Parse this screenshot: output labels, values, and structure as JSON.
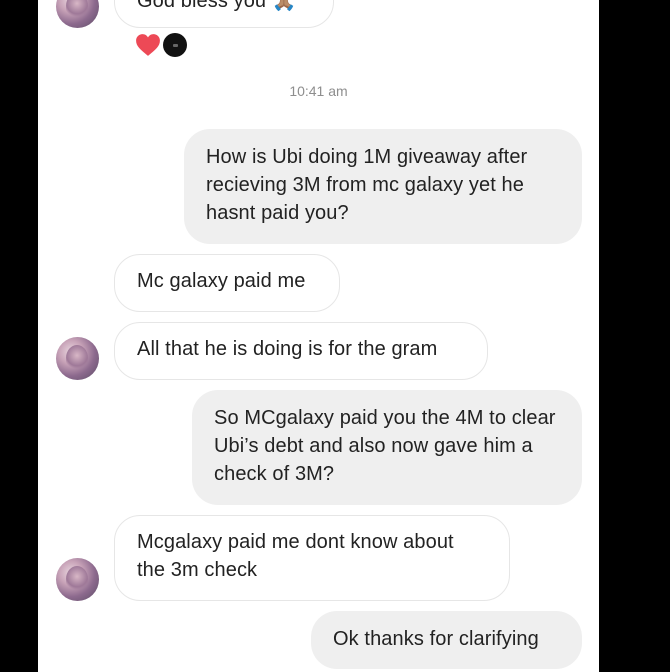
{
  "conversation": {
    "messages": [
      {
        "id": "m0",
        "direction": "received",
        "text": "God bless you 🙏🏽"
      },
      {
        "id": "m1",
        "direction": "sent",
        "text": "How is Ubi doing 1M giveaway after recieving 3M from mc galaxy yet he hasnt paid you?"
      },
      {
        "id": "m2",
        "direction": "received",
        "text": "Mc galaxy paid me"
      },
      {
        "id": "m3",
        "direction": "received",
        "text": "All that he is doing is for the gram"
      },
      {
        "id": "m4",
        "direction": "sent",
        "text": "So MCgalaxy paid you the 4M to clear Ubi’s debt and also now gave him a check of 3M?"
      },
      {
        "id": "m5",
        "direction": "received",
        "text": "Mcgalaxy paid me dont know about the 3m check"
      },
      {
        "id": "m6",
        "direction": "sent",
        "text": "Ok thanks for clarifying"
      }
    ],
    "timestamp": "10:41 am",
    "reactions": [
      "heart-icon",
      "reactor-avatar-icon"
    ]
  },
  "colors": {
    "sent_bubble": "#efefef",
    "received_border": "#e6e6e6",
    "heart": "#ed4956",
    "timestamp_text": "#8e8e8e"
  }
}
